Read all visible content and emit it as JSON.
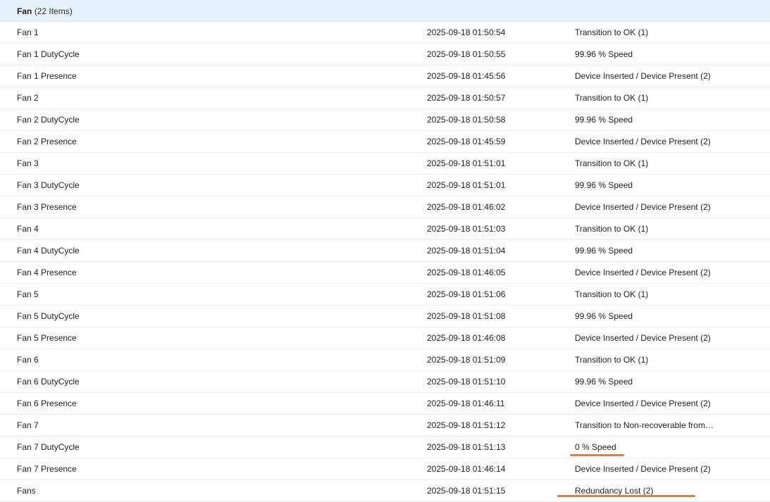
{
  "group": {
    "name": "Fan",
    "count_label": "(22 Items)"
  },
  "rows": [
    {
      "name": "Fan 1",
      "time": "2025-09-18 01:50:54",
      "status": "Transition to OK (1)"
    },
    {
      "name": "Fan 1 DutyCycle",
      "time": "2025-09-18 01:50:55",
      "status": "99.96 % Speed"
    },
    {
      "name": "Fan 1 Presence",
      "time": "2025-09-18 01:45:56",
      "status": "Device Inserted / Device Present (2)"
    },
    {
      "name": "Fan 2",
      "time": "2025-09-18 01:50:57",
      "status": "Transition to OK (1)"
    },
    {
      "name": "Fan 2 DutyCycle",
      "time": "2025-09-18 01:50:58",
      "status": "99.96 % Speed"
    },
    {
      "name": "Fan 2 Presence",
      "time": "2025-09-18 01:45:59",
      "status": "Device Inserted / Device Present (2)"
    },
    {
      "name": "Fan 3",
      "time": "2025-09-18 01:51:01",
      "status": "Transition to OK (1)"
    },
    {
      "name": "Fan 3 DutyCycle",
      "time": "2025-09-18 01:51:01",
      "status": "99.96 % Speed"
    },
    {
      "name": "Fan 3 Presence",
      "time": "2025-09-18 01:46:02",
      "status": "Device Inserted / Device Present (2)"
    },
    {
      "name": "Fan 4",
      "time": "2025-09-18 01:51:03",
      "status": "Transition to OK (1)"
    },
    {
      "name": "Fan 4 DutyCycle",
      "time": "2025-09-18 01:51:04",
      "status": "99.96 % Speed"
    },
    {
      "name": "Fan 4 Presence",
      "time": "2025-09-18 01:46:05",
      "status": "Device Inserted / Device Present (2)"
    },
    {
      "name": "Fan 5",
      "time": "2025-09-18 01:51:06",
      "status": "Transition to OK (1)"
    },
    {
      "name": "Fan 5 DutyCycle",
      "time": "2025-09-18 01:51:08",
      "status": "99.96 % Speed"
    },
    {
      "name": "Fan 5 Presence",
      "time": "2025-09-18 01:46:08",
      "status": "Device Inserted / Device Present (2)"
    },
    {
      "name": "Fan 6",
      "time": "2025-09-18 01:51:09",
      "status": "Transition to OK (1)"
    },
    {
      "name": "Fan 6 DutyCycle",
      "time": "2025-09-18 01:51:10",
      "status": "99.96 % Speed"
    },
    {
      "name": "Fan 6 Presence",
      "time": "2025-09-18 01:46:11",
      "status": "Device Inserted / Device Present (2)"
    },
    {
      "name": "Fan 7",
      "time": "2025-09-18 01:51:12",
      "status": "Transition to Non-recoverable from…"
    },
    {
      "name": "Fan 7 DutyCycle",
      "time": "2025-09-18 01:51:13",
      "status": "0 % Speed"
    },
    {
      "name": "Fan 7 Presence",
      "time": "2025-09-18 01:46:14",
      "status": "Device Inserted / Device Present (2)"
    },
    {
      "name": "Fans",
      "time": "2025-09-18 01:51:15",
      "status": "Redundancy Lost (2)"
    }
  ],
  "annotation_color": "#f07b2c"
}
